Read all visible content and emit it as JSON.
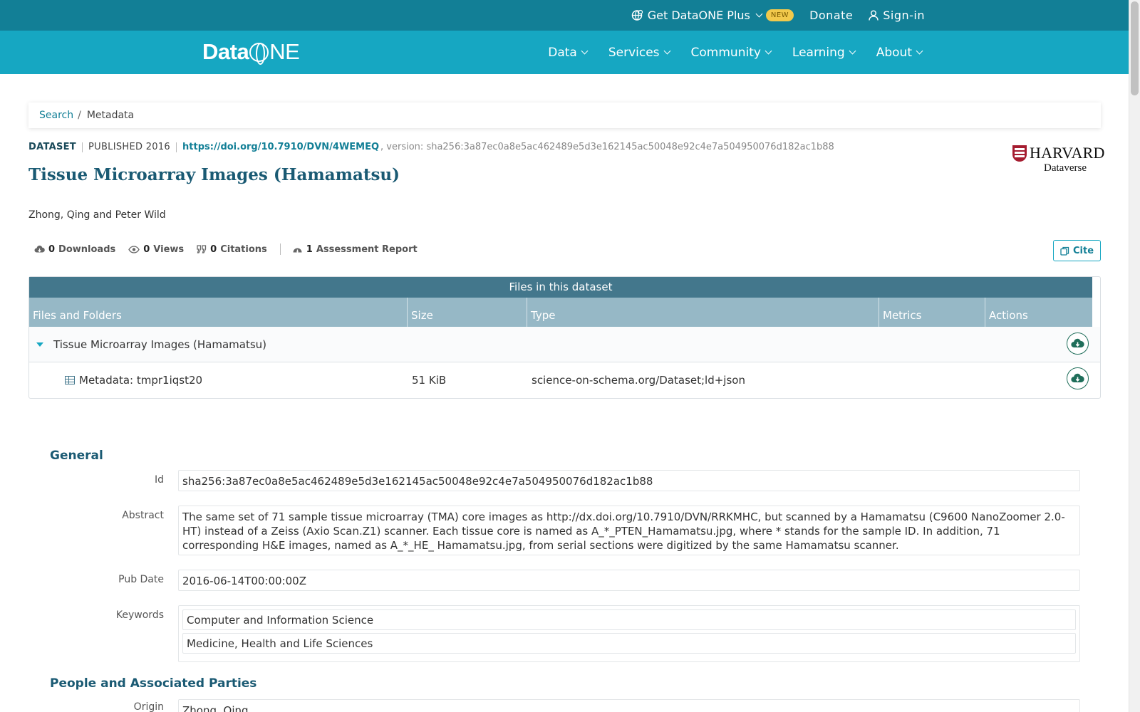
{
  "topbar": {
    "plus_label": "Get DataONE Plus",
    "plus_badge": "NEW",
    "donate_label": "Donate",
    "signin_label": "Sign-in"
  },
  "nav": {
    "logo_prefix": "Data",
    "logo_suffix": "NE",
    "items": [
      "Data",
      "Services",
      "Community",
      "Learning",
      "About"
    ]
  },
  "breadcrumb": {
    "search": "Search",
    "current": "Metadata"
  },
  "dataset": {
    "type": "DATASET",
    "published": "PUBLISHED 2016",
    "doi": "https://doi.org/10.7910/DVN/4WEMEQ",
    "version": ", version: sha256:3a87ec0a8e5ac462489e5d3e162145ac50048e92c4e7a504950076d182ac1b88",
    "title": "Tissue Microarray Images (Hamamatsu)",
    "authors": "Zhong, Qing and Peter Wild",
    "repo_name": "HARVARD",
    "repo_sub": "Dataverse"
  },
  "stats": {
    "downloads_count": "0",
    "downloads_label": "Downloads",
    "views_count": "0",
    "views_label": "Views",
    "citations_count": "0",
    "citations_label": "Citations",
    "assessment_count": "1",
    "assessment_label": "Assessment Report",
    "cite_label": "Cite"
  },
  "files": {
    "heading": "Files in this dataset",
    "columns": [
      "Files and Folders",
      "Size",
      "Type",
      "Metrics",
      "Actions"
    ],
    "folder_name": "Tissue Microarray Images (Hamamatsu)",
    "rows": [
      {
        "name": "Metadata: tmpr1iqst20",
        "size": "51 KiB",
        "type": "science-on-schema.org/Dataset;ld+json"
      }
    ]
  },
  "general": {
    "title": "General",
    "id_label": "Id",
    "id_value": "sha256:3a87ec0a8e5ac462489e5d3e162145ac50048e92c4e7a504950076d182ac1b88",
    "abstract_label": "Abstract",
    "abstract_value": "The same set of 71 sample tissue microarray (TMA) core images as http://dx.doi.org/10.7910/DVN/RRKMHC, but scanned by a Hamamatsu (C9600 NanoZoomer 2.0-HT) instead of a Zeiss (Axio Scan.Z1) scanner. Each tissue core is named as A_*_PTEN_Hamamatsu.jpg, where * stands for the sample ID. In addition, 71 corresponding H&E images, named as A_*_HE_ Hamamatsu.jpg, from serial sections were digitized by the same Hamamatsu scanner.",
    "pubdate_label": "Pub Date",
    "pubdate_value": "2016-06-14T00:00:00Z",
    "keywords_label": "Keywords",
    "keywords": [
      "Computer and Information Science",
      "Medicine, Health and Life Sciences"
    ]
  },
  "people": {
    "title": "People and Associated Parties",
    "origin_label": "Origin",
    "origin_value": "Zhong, Qing"
  }
}
